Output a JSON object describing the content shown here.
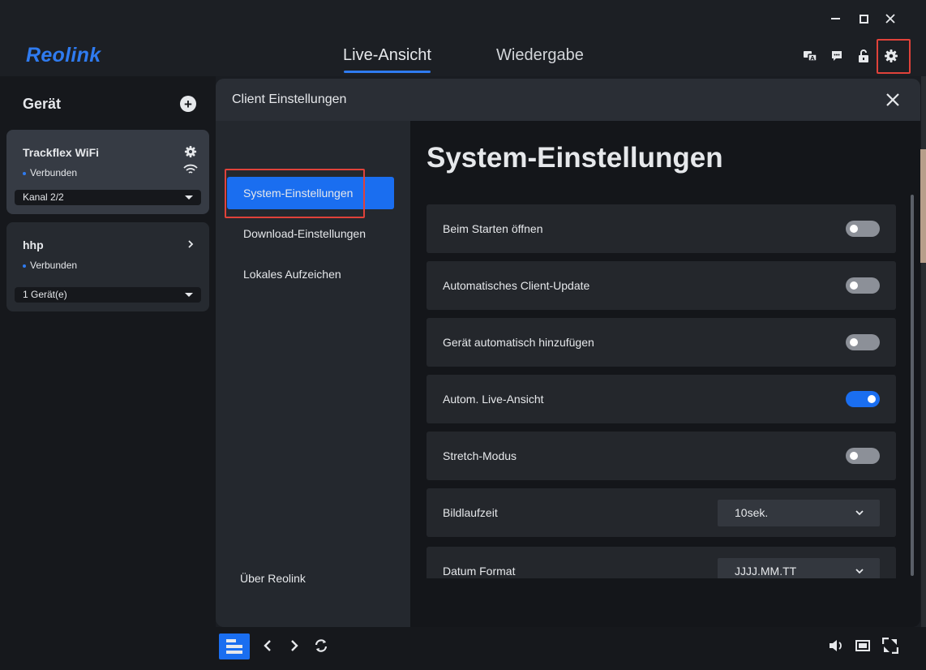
{
  "window": {
    "minimize_icon": "minimize-icon",
    "maximize_icon": "maximize-icon",
    "close_icon": "close-icon"
  },
  "header": {
    "logo": "Reolink",
    "tabs": [
      {
        "label": "Live-Ansicht",
        "active": true
      },
      {
        "label": "Wiedergabe",
        "active": false
      }
    ],
    "icons": [
      "translate-icon",
      "message-icon",
      "unlock-icon",
      "gear-icon"
    ],
    "accent_color": "#1a6ef0"
  },
  "sidebar": {
    "title": "Gerät",
    "devices": [
      {
        "name": "Trackflex WiFi",
        "status": "Verbunden",
        "select": "Kanal 2/2"
      },
      {
        "name": "hhp",
        "status": "Verbunden",
        "select": "1 Gerät(e)"
      }
    ]
  },
  "modal": {
    "title": "Client Einstellungen",
    "nav": [
      "System-Einstellungen",
      "Download-Einstellungen",
      "Lokales Aufzeichen"
    ],
    "nav_active": "System-Einstellungen",
    "about": "Über Reolink",
    "content_title": "System-Einstellungen",
    "settings": [
      {
        "label": "Beim Starten öffnen",
        "type": "toggle",
        "value": false
      },
      {
        "label": "Automatisches Client-Update",
        "type": "toggle",
        "value": false
      },
      {
        "label": "Gerät automatisch hinzufügen",
        "type": "toggle",
        "value": false
      },
      {
        "label": "Autom. Live-Ansicht",
        "type": "toggle",
        "value": true
      },
      {
        "label": "Stretch-Modus",
        "type": "toggle",
        "value": false
      },
      {
        "label": "Bildlaufzeit",
        "type": "select",
        "value": "10sek."
      },
      {
        "label": "Datum Format",
        "type": "select",
        "value": "JJJJ.MM.TT"
      }
    ]
  },
  "bottombar": {
    "icons": [
      "layout-icon",
      "chevron-left-icon",
      "chevron-right-icon",
      "refresh-icon",
      "volume-icon",
      "screen-icon",
      "fullscreen-icon"
    ]
  }
}
